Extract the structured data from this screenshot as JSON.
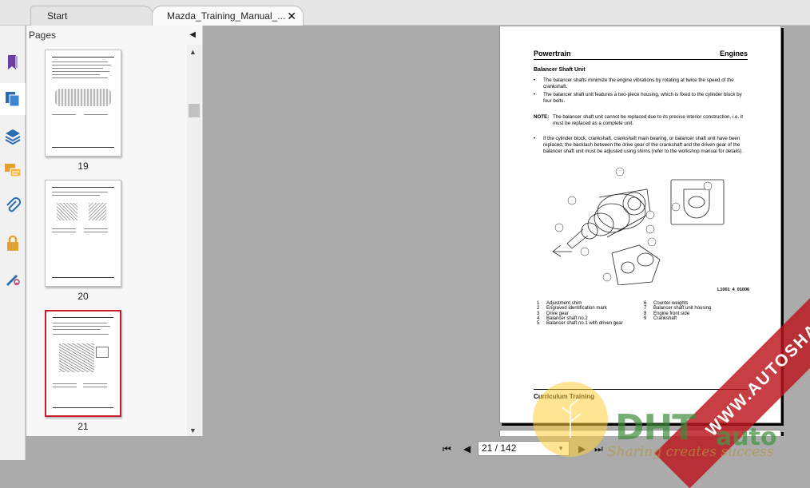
{
  "tabs": {
    "start_label": "Start",
    "doc_label": "Mazda_Training_Manual_...",
    "close_glyph": "✕"
  },
  "toolbar_icons": [
    "bookmark-icon",
    "pages-icon",
    "layers-icon",
    "comments-icon",
    "attachment-icon",
    "security-icon",
    "signature-icon"
  ],
  "pages_panel": {
    "title": "Pages",
    "thumbnails": [
      {
        "number": "19"
      },
      {
        "number": "20"
      },
      {
        "number": "21",
        "selected": true
      }
    ]
  },
  "document": {
    "header_left": "Powertrain",
    "header_right": "Engines",
    "section_title": "Balancer Shaft Unit",
    "bullet1": "The balancer shafts minimize the engine vibrations by rotating at twice the speed of the crankshaft.",
    "bullet2": "The balancer shaft unit features a two-piece housing, which is fixed to the cylinder block by four bolts.",
    "note_label": "NOTE:",
    "note_text": "The balancer shaft unit cannot be replaced due to its precise interior construction, i.e. it must be replaced as a complete unit.",
    "bullet3": "If the cylinder block, crankshaft, crankshaft main bearing, or balancer shaft unit have been replaced, the backlash between the drive gear of the crankshaft and the driven gear of the balancer shaft unit must be adjusted using shims (refer to the workshop manual for details).",
    "figure_id": "L1001_4_01006",
    "legend": [
      {
        "n": "1",
        "t": "Adjustment shim"
      },
      {
        "n": "2",
        "t": "Engraved identification mark"
      },
      {
        "n": "3",
        "t": "Drive gear"
      },
      {
        "n": "4",
        "t": "Balancer shaft no.2"
      },
      {
        "n": "5",
        "t": "Balancer shaft no.1 with driven gear"
      },
      {
        "n": "6",
        "t": "Counter weights"
      },
      {
        "n": "7",
        "t": "Balancer shaft unit housing"
      },
      {
        "n": "8",
        "t": "Engine front side"
      },
      {
        "n": "9",
        "t": "Crankshaft"
      }
    ],
    "footer": "Curriculum Training"
  },
  "navigation": {
    "page_indicator": "21 / 142"
  },
  "watermark": {
    "banner_text": "WWW.AUTOSHARE.ASIA",
    "logo_text": "DHT",
    "auto_text": "auto",
    "slogan": "Sharing creates success"
  }
}
